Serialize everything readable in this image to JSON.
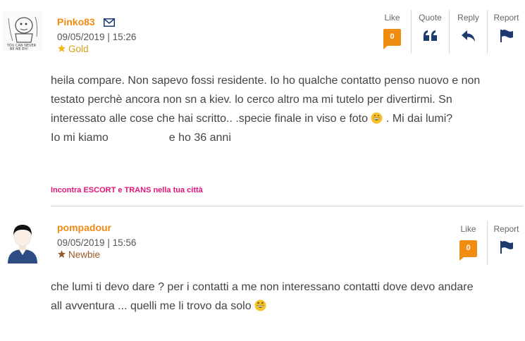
{
  "posts": [
    {
      "author": "Pinko83",
      "date": "09/05/2019 | 15:26",
      "rank": "Gold",
      "actions": {
        "like_label": "Like",
        "like_count": "0",
        "quote_label": "Quote",
        "reply_label": "Reply",
        "report_label": "Report"
      },
      "lines": [
        "heila compare. Non sapevo fossi residente. Io ho qualche contatto penso nuovo e non",
        "testato perchè ancora non sn a kiev. lo cerco altro ma mi tutelo per divertirmi. Sn",
        "interessato alle cose che hai scritto.. .specie finale in viso e foto",
        ". Mi dai lumi?",
        "Io mi kiamo",
        "e ho 36 anni"
      ]
    },
    {
      "author": "pompadour",
      "date": "09/05/2019 | 15:56",
      "rank": "Newbie",
      "actions": {
        "like_label": "Like",
        "like_count": "0",
        "report_label": "Report"
      },
      "lines": [
        "che lumi ti devo dare ? per i contatti a me non interessano contatti dove devo andare",
        "all avventura ... quelli me li trovo da solo"
      ]
    }
  ],
  "promo": {
    "text": "Incontra ESCORT e TRANS nella tua città"
  },
  "colors": {
    "username": "#f18a12",
    "like_badge": "#f08c10",
    "promo": "#e0147a",
    "icons": "#1f3a6e"
  },
  "icons": [
    "envelope-icon",
    "star-icon",
    "quote-icon",
    "reply-icon",
    "flag-icon",
    "grinning-emoji"
  ]
}
